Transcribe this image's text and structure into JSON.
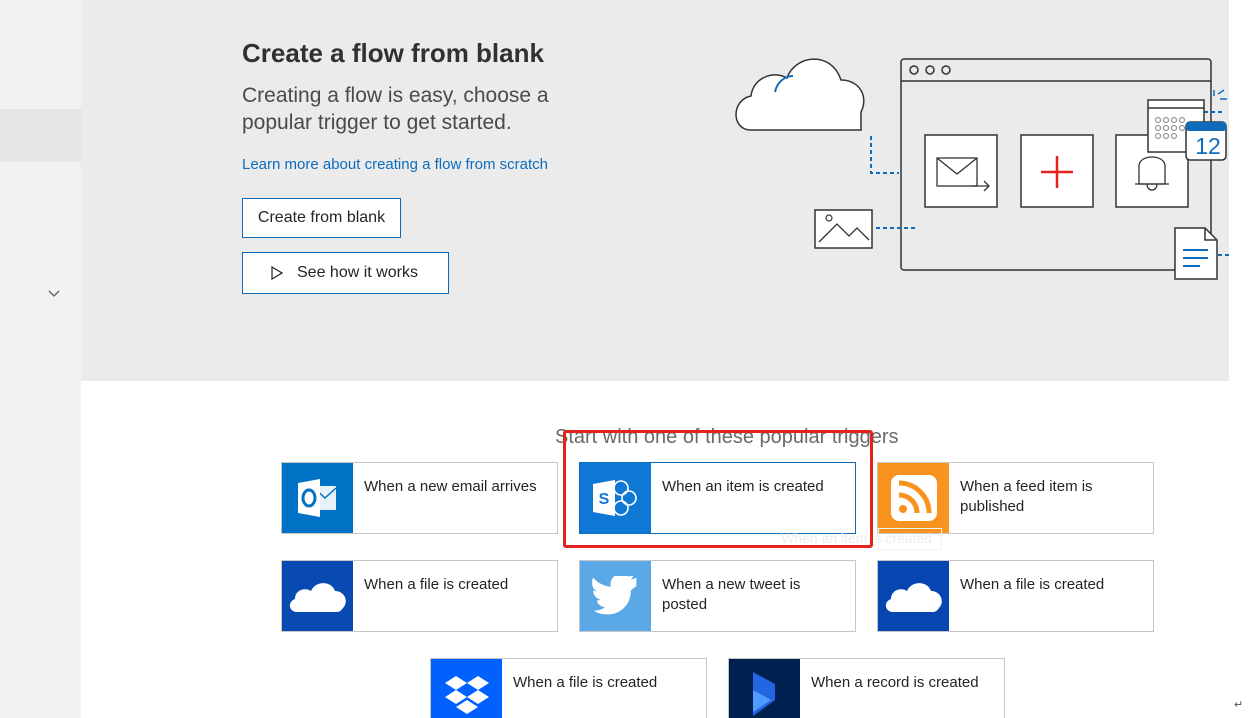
{
  "hero": {
    "title": "Create a flow from blank",
    "subtitle": "Creating a flow is easy, choose a popular trigger to get started.",
    "learn_link": "Learn more about creating a flow from scratch",
    "create_button": "Create from blank",
    "how_button": "See how it works"
  },
  "illustration": {
    "calendar_day": "12"
  },
  "triggers": {
    "title": "Start with one of these popular triggers",
    "ghost_text": "When an item is created",
    "items": [
      {
        "label": "When a new email arrives",
        "icon": "outlook-icon",
        "color": "#0072c6"
      },
      {
        "label": "When an item is created",
        "icon": "sharepoint-icon",
        "color": "#0f78d4"
      },
      {
        "label": "When a feed item is published",
        "icon": "rss-icon",
        "color": "#f7931e"
      },
      {
        "label": "When a file is created",
        "icon": "onedrive-icon",
        "color": "#094ab2"
      },
      {
        "label": "When a new tweet is posted",
        "icon": "twitter-icon",
        "color": "#5aa9e6"
      },
      {
        "label": "When a file is created",
        "icon": "onedrive-business-icon",
        "color": "#0745b0"
      },
      {
        "label": "When a file is created",
        "icon": "dropbox-icon",
        "color": "#0061ff"
      },
      {
        "label": "When a record is created",
        "icon": "dynamics-icon",
        "color": "#002050"
      }
    ]
  },
  "highlight_color": "#e5211b",
  "accent_color": "#0f6cbd"
}
